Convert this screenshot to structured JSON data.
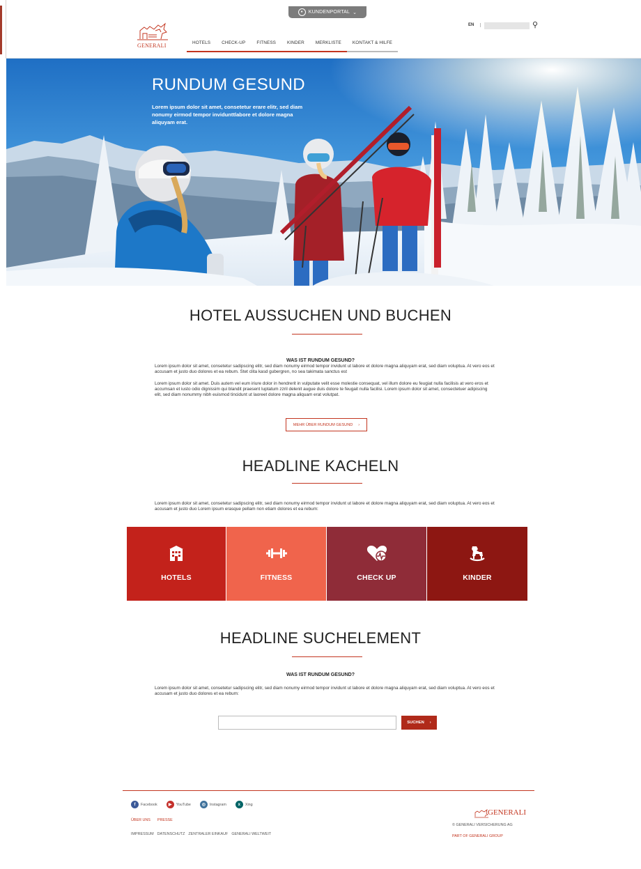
{
  "header": {
    "portal_label": "KUNDENPORTAL",
    "logo_text": "GENERALI",
    "nav": [
      "HOTELS",
      "CHECK-UP",
      "FITNESS",
      "KINDER",
      "MERKLISTE",
      "KONTAKT & HILFE"
    ],
    "language": "EN",
    "search_value": ""
  },
  "hero": {
    "title": "RUNDUM GESUND",
    "text": "Lorem ipsum dolor sit amet, consetetur erare elitr, sed diam nonumy eirmod tempor invidunttlabore et dolore magna aliquyam erat."
  },
  "section1": {
    "title": "HOTEL AUSSUCHEN UND BUCHEN",
    "subhead": "WAS IST RUNDUM GESUND?",
    "para1": "Lorem ipsum dolor sit amet, consetetur sadipscing elitr, sed diam nonumy eirmod tempor invidunt ut labore et dolore magna aliquyam erat, sed diam voluptua. At vero eos et accusam et justo duo dolores et ea rebum. Stet clita kasd gubergren, no sea takimata sanctus est",
    "para2": "Lorem ipsum dolor sit amet. Duis autem vel eum iriure dolor in hendrerit in vulputate velit esse molestie consequat, vel illum dolore eu feugiat nulla facilisis at vero eros et accumsan et iusto odio dignissim qui blandit praesent luptatum zzril delenit augue duis dolore te feugait nulla facilisi. Lorem ipsum dolor sit amet, consectetuer adipiscing elit, sed diam nonummy nibh euismod tincidunt ut laoreet dolore magna aliquam erat volutpat.",
    "button": "MEHR ÜBER RUNDUM GESUND"
  },
  "section2": {
    "title": "HEADLINE KACHELN",
    "para": "Lorem ipsum dolor sit amet, consetetur sadipscing elitr, sed diam nonumy eirmod tempor invidunt ut labore et dolore magna aliquyam erat, sed diam voluptua. At vero eos et accusam et justo duo Lorem ipsum erasque pellam non etiam dolores et ea rebum:",
    "tiles": [
      {
        "label": "HOTELS",
        "icon": "hotel-icon",
        "color": "#c3221b"
      },
      {
        "label": "FITNESS",
        "icon": "dumbbell-icon",
        "color": "#f0644c"
      },
      {
        "label": "CHECK UP",
        "icon": "heart-pulse-icon",
        "color": "#8f2c38"
      },
      {
        "label": "KINDER",
        "icon": "rocking-horse-icon",
        "color": "#8d1712"
      }
    ]
  },
  "section3": {
    "title": "HEADLINE SUCHELEMENT",
    "subhead": "WAS IST RUNDUM GESUND?",
    "para": "Lorem ipsum dolor sit amet, consetetur sadipscing elitr, sed diam nonumy eirmod tempor invidunt ut labore et dolore magna aliquyam erat, sed diam voluptua. At vero eos et accusam et justo duo dolores et ea rebum:",
    "search_value": "",
    "search_button": "SUCHEN"
  },
  "footer": {
    "social": [
      {
        "label": "Facebook",
        "icon": "facebook-icon",
        "color": "#3b5998"
      },
      {
        "label": "YouTube",
        "icon": "youtube-icon",
        "color": "#c4302b"
      },
      {
        "label": "Instagram",
        "icon": "instagram-icon",
        "color": "#3f729b"
      },
      {
        "label": "Xing",
        "icon": "xing-icon",
        "color": "#026466"
      }
    ],
    "links1": [
      "ÜBER UNS",
      "PRESSE"
    ],
    "links2": [
      "IMPRESSUM",
      "DATENSCHUTZ",
      "ZENTRALER EINKAUF",
      "GENERALI WELTWEIT"
    ],
    "logo_text": "GENERALI",
    "copyright": "© GENERALI VERSICHERUNG AG",
    "group": "PART OF GENERALI GROUP"
  },
  "colors": {
    "accent": "#c3351f"
  }
}
